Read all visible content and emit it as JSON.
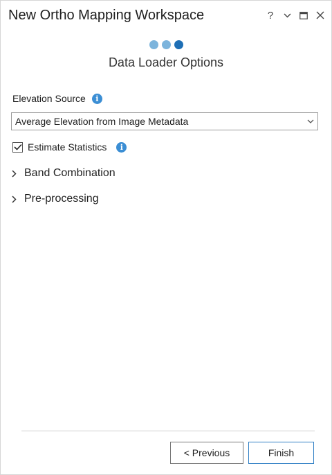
{
  "window": {
    "title": "New Ortho Mapping Workspace",
    "help_glyph": "?",
    "options_glyph": "⌄",
    "maximize_glyph": "▭",
    "close_glyph": "✕"
  },
  "wizard": {
    "steps": [
      {
        "state": "completed",
        "color": "#7cb4dc"
      },
      {
        "state": "completed",
        "color": "#7cb4dc"
      },
      {
        "state": "current",
        "color": "#1e6fb5"
      }
    ],
    "page_title": "Data Loader Options"
  },
  "elevation_source": {
    "label": "Elevation Source",
    "info_glyph": "i",
    "selected_value": "Average Elevation from Image Metadata"
  },
  "estimate_statistics": {
    "label": "Estimate Statistics",
    "checked": true,
    "info_glyph": "i"
  },
  "sections": [
    {
      "label": "Band Combination",
      "expanded": false
    },
    {
      "label": "Pre-processing",
      "expanded": false
    }
  ],
  "footer": {
    "previous_label": "< Previous",
    "finish_label": "Finish"
  },
  "colors": {
    "accent": "#1e6fb5",
    "info": "#3b8ed4",
    "step_done": "#7cb4dc"
  }
}
